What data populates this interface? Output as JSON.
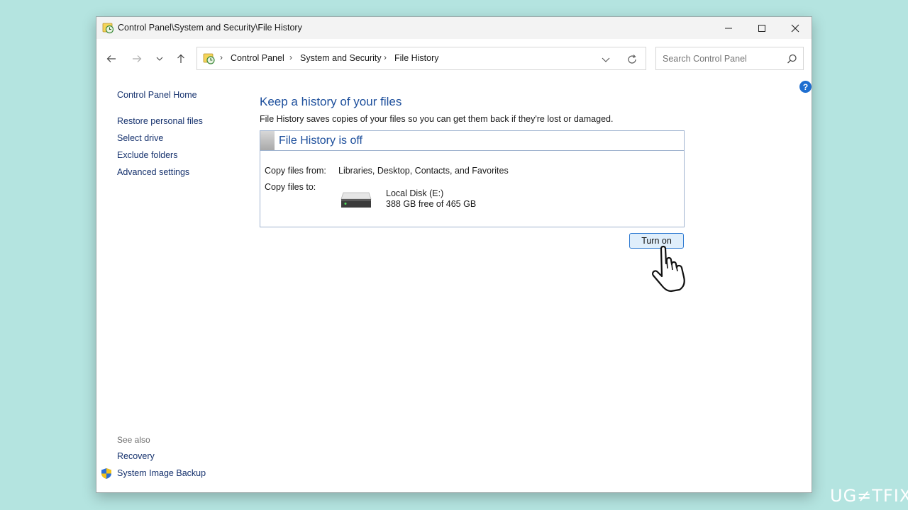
{
  "window": {
    "title": "Control Panel\\System and Security\\File History"
  },
  "address": {
    "crumbs": [
      "Control Panel",
      "System and Security",
      "File History"
    ]
  },
  "search": {
    "placeholder": "Search Control Panel"
  },
  "sidebar": {
    "home": "Control Panel Home",
    "items": [
      {
        "label": "Restore personal files"
      },
      {
        "label": "Select drive"
      },
      {
        "label": "Exclude folders"
      },
      {
        "label": "Advanced settings"
      }
    ],
    "see_also_label": "See also",
    "see_also": [
      {
        "label": "Recovery"
      },
      {
        "label": "System Image Backup"
      }
    ]
  },
  "main": {
    "heading": "Keep a history of your files",
    "description": "File History saves copies of your files so you can get them back if they're lost or damaged.",
    "status_title": "File History is off",
    "copy_from_label": "Copy files from:",
    "copy_from_value": "Libraries, Desktop, Contacts, and Favorites",
    "copy_to_label": "Copy files to:",
    "drive_name": "Local Disk (E:)",
    "drive_space": "388 GB free of 465 GB",
    "turn_on_label": "Turn on"
  },
  "watermark": "UG≠TFIX",
  "icons": {
    "title": "file-history-icon",
    "back": "arrow-left-icon",
    "forward": "arrow-right-icon",
    "recent": "chevron-down-icon",
    "up": "arrow-up-icon",
    "refresh": "refresh-icon",
    "search": "search-icon",
    "help": "help-icon",
    "shield": "shield-icon",
    "drive": "drive-icon",
    "cursor": "hand-cursor-icon"
  },
  "colors": {
    "background": "#b4e4e0",
    "link": "#16326e",
    "heading": "#1d4f9c",
    "button_fill": "#dfeefb",
    "button_border": "#2f7bd2"
  }
}
